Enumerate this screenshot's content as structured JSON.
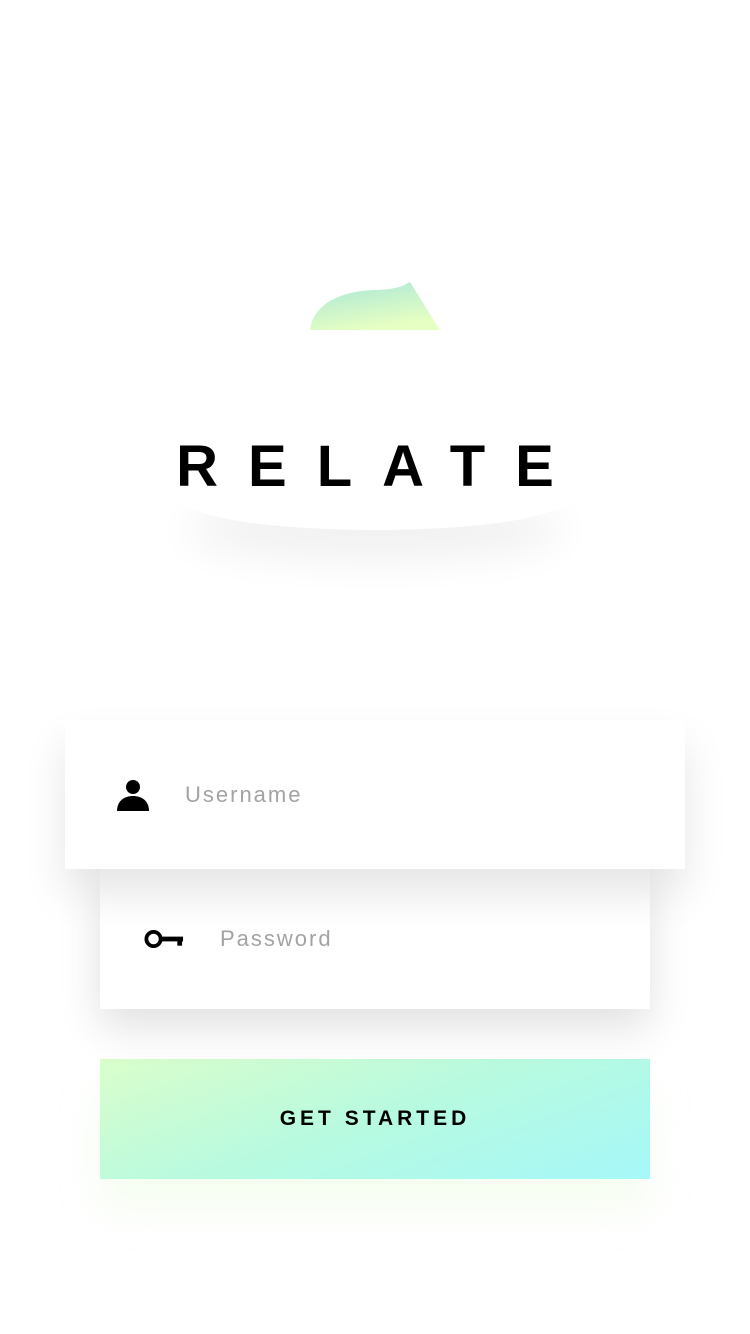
{
  "brand": {
    "title": "RELATE",
    "logo_icon": "leaf-wave-logo-icon",
    "logo_colors": [
      "#a8e9d6",
      "#e4ffc4"
    ]
  },
  "login_form": {
    "username": {
      "icon": "user-icon",
      "placeholder": "Username",
      "value": ""
    },
    "password": {
      "icon": "key-icon",
      "placeholder": "Password",
      "value": ""
    },
    "submit_label": "GET STARTED",
    "submit_gradient": [
      "#dafecb",
      "#a6f8f9"
    ]
  }
}
